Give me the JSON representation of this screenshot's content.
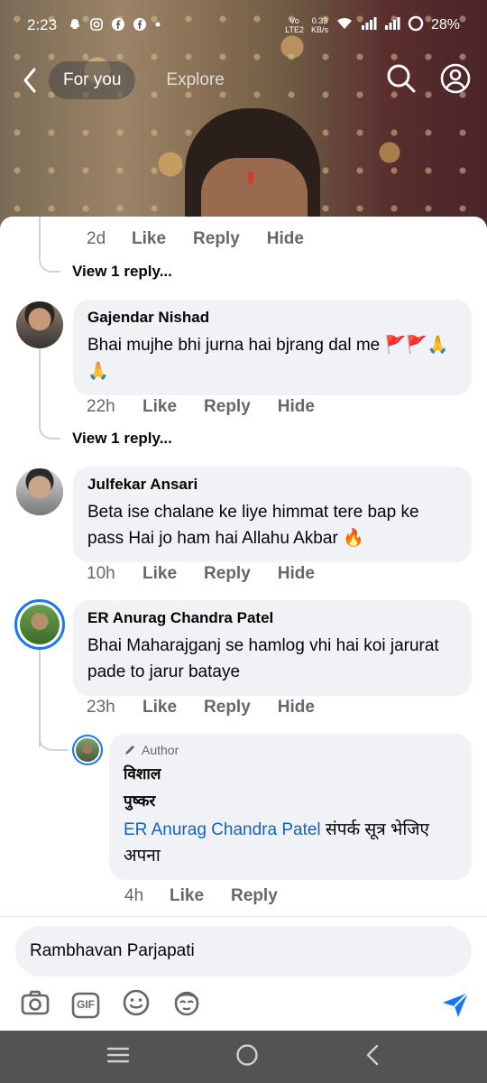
{
  "status_bar": {
    "time": "2:23",
    "net_label_top": "Vo",
    "net_label_bottom": "LTE2",
    "speed_top": "0.33",
    "speed_bottom": "KB/s",
    "battery": "28%"
  },
  "top_nav": {
    "tabs": [
      {
        "label": "For you"
      },
      {
        "label": "Explore"
      }
    ]
  },
  "comments": {
    "first_actions": {
      "time": "2d",
      "like": "Like",
      "reply": "Reply",
      "hide": "Hide"
    },
    "view_reply_1": "View 1 reply...",
    "c1": {
      "name": "Gajendar Nishad",
      "text": "Bhai mujhe bhi jurna hai bjrang dal me 🚩🚩🙏🙏",
      "time": "22h",
      "like": "Like",
      "reply": "Reply",
      "hide": "Hide"
    },
    "view_reply_2": "View 1 reply...",
    "c2": {
      "name": "Julfekar Ansari",
      "text": "Beta ise chalane ke liye himmat tere bap ke pass Hai jo ham hai Allahu Akbar 🔥",
      "time": "10h",
      "like": "Like",
      "reply": "Reply",
      "hide": "Hide"
    },
    "c3": {
      "name": "ER Anurag Chandra Patel",
      "text": "Bhai Maharajganj se hamlog vhi hai koi jarurat pade to jarur bataye",
      "time": "23h",
      "like": "Like",
      "reply": "Reply",
      "hide": "Hide"
    },
    "reply": {
      "author_tag": "Author",
      "name_line1": "विशाल",
      "name_line2": "पुष्कर",
      "mention": "ER Anurag Chandra Patel",
      "text": " संपर्क सूत्र भेजिए अपना",
      "time": "4h",
      "like": "Like",
      "reply": "Reply"
    }
  },
  "composer": {
    "value": "Rambhavan Parjapati",
    "gif_label": "GIF"
  },
  "colors": {
    "accent": "#1877f2",
    "bubble": "#f0f2f5",
    "meta_text": "#65676b",
    "system_nav": "#535353"
  }
}
